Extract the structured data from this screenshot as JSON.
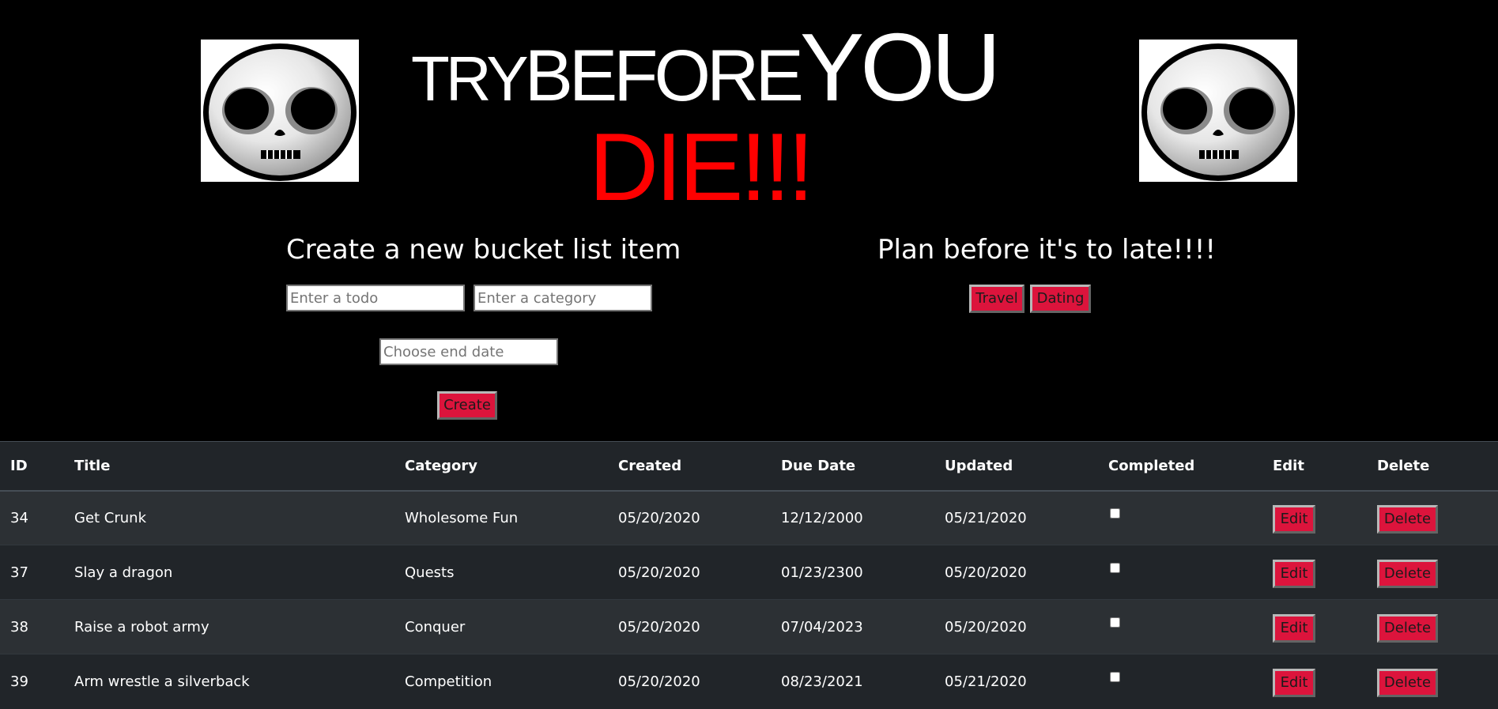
{
  "header": {
    "logo": {
      "try": "TRY",
      "before": "BEFORE",
      "you": "YOU",
      "die": "DIE!!!"
    },
    "mascot_icon": "skull-emoji-icon"
  },
  "create_form": {
    "title": "Create a new bucket list item",
    "todo_placeholder": "Enter a todo",
    "category_placeholder": "Enter a category",
    "date_placeholder": "Choose end date",
    "create_label": "Create"
  },
  "plan": {
    "title": "Plan before it's to late!!!!",
    "filters": [
      "Travel",
      "Dating"
    ]
  },
  "table": {
    "headers": [
      "ID",
      "Title",
      "Category",
      "Created",
      "Due Date",
      "Updated",
      "Completed",
      "Edit",
      "Delete"
    ],
    "rows": [
      {
        "id": "34",
        "title": "Get Crunk",
        "category": "Wholesome Fun",
        "created": "05/20/2020",
        "due": "12/12/2000",
        "updated": "05/21/2020",
        "completed": false,
        "edit": "Edit",
        "delete": "Delete"
      },
      {
        "id": "37",
        "title": "Slay a dragon",
        "category": "Quests",
        "created": "05/20/2020",
        "due": "01/23/2300",
        "updated": "05/20/2020",
        "completed": false,
        "edit": "Edit",
        "delete": "Delete"
      },
      {
        "id": "38",
        "title": "Raise a robot army",
        "category": "Conquer",
        "created": "05/20/2020",
        "due": "07/04/2023",
        "updated": "05/20/2020",
        "completed": false,
        "edit": "Edit",
        "delete": "Delete"
      },
      {
        "id": "39",
        "title": "Arm wrestle a silverback",
        "category": "Competition",
        "created": "05/20/2020",
        "due": "08/23/2021",
        "updated": "05/21/2020",
        "completed": false,
        "edit": "Edit",
        "delete": "Delete"
      }
    ]
  },
  "colors": {
    "background": "#000000",
    "accent": "#dc143c",
    "die_red": "#ff0000",
    "table_dark": "#212529",
    "table_stripe": "#2c3034"
  }
}
